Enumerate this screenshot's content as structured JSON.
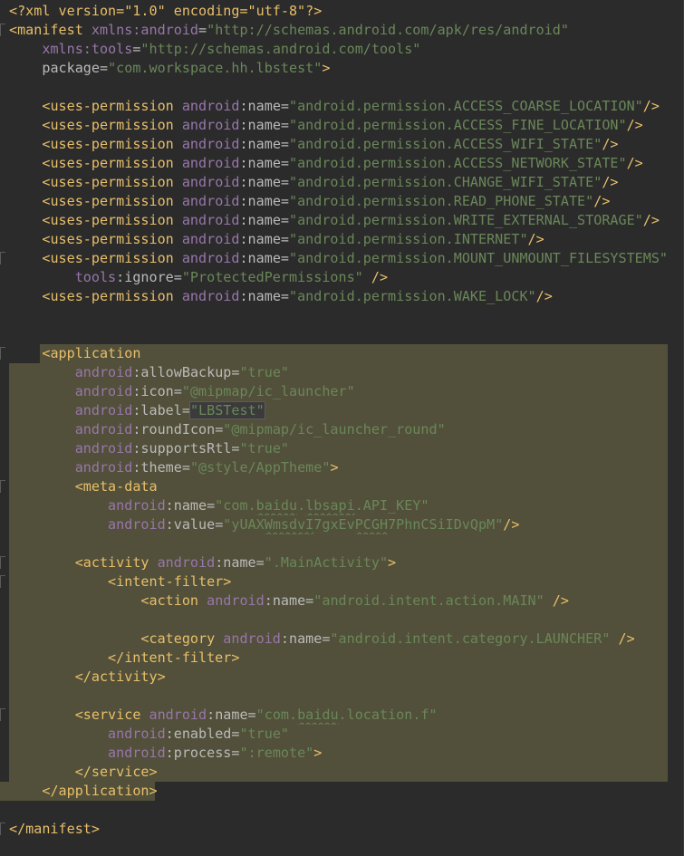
{
  "lines": [
    {
      "t": "decl",
      "text": "<?xml version=\"1.0\" encoding=\"utf-8\"?>"
    },
    {
      "t": "raw",
      "parts": [
        [
          "tag",
          "<manifest "
        ],
        [
          "ns",
          "xmlns:"
        ],
        [
          "attr",
          ""
        ],
        [
          "ns",
          "android"
        ],
        [
          "attr",
          "="
        ],
        [
          "val",
          "\"http://schemas.android.com/apk/res/android\""
        ]
      ]
    },
    {
      "t": "raw",
      "indent": "    ",
      "parts": [
        [
          "ns",
          "xmlns:"
        ],
        [
          "ns",
          "tools"
        ],
        [
          "attr",
          "="
        ],
        [
          "val",
          "\"http://schemas.android.com/tools\""
        ]
      ]
    },
    {
      "t": "raw",
      "indent": "    ",
      "parts": [
        [
          "attr",
          "package"
        ],
        [
          "attr",
          "="
        ],
        [
          "val",
          "\"com.workspace.hh.lbstest\""
        ],
        [
          "tag",
          ">"
        ]
      ]
    },
    {
      "t": "blank"
    },
    {
      "t": "perm",
      "value": "\"android.permission.ACCESS_COARSE_LOCATION\""
    },
    {
      "t": "perm",
      "value": "\"android.permission.ACCESS_FINE_LOCATION\""
    },
    {
      "t": "perm",
      "value": "\"android.permission.ACCESS_WIFI_STATE\""
    },
    {
      "t": "perm",
      "value": "\"android.permission.ACCESS_NETWORK_STATE\""
    },
    {
      "t": "perm",
      "value": "\"android.permission.CHANGE_WIFI_STATE\""
    },
    {
      "t": "perm",
      "value": "\"android.permission.READ_PHONE_STATE\""
    },
    {
      "t": "perm",
      "value": "\"android.permission.WRITE_EXTERNAL_STORAGE\""
    },
    {
      "t": "perm",
      "value": "\"android.permission.INTERNET\""
    },
    {
      "t": "perm_open",
      "value": "\"android.permission.MOUNT_UNMOUNT_FILESYSTEMS\""
    },
    {
      "t": "raw",
      "indent": "        ",
      "parts": [
        [
          "ns",
          "tools"
        ],
        [
          "attr",
          ":ignore="
        ],
        [
          "val",
          "\"ProtectedPermissions\""
        ],
        [
          "tag",
          " />"
        ]
      ]
    },
    {
      "t": "perm",
      "value": "\"android.permission.WAKE_LOCK\""
    },
    {
      "t": "blank"
    },
    {
      "t": "blank"
    },
    {
      "t": "app_open",
      "text": "<application"
    },
    {
      "t": "sel",
      "indent": "        ",
      "parts": [
        [
          "ns",
          "android"
        ],
        [
          "attr",
          ":allowBackup="
        ],
        [
          "val",
          "\"true\""
        ]
      ]
    },
    {
      "t": "sel",
      "indent": "        ",
      "parts": [
        [
          "ns",
          "android"
        ],
        [
          "attr",
          ":icon="
        ],
        [
          "val",
          "\"@mipmap/ic_launcher\""
        ]
      ]
    },
    {
      "t": "sel",
      "indent": "        ",
      "parts": [
        [
          "ns",
          "android"
        ],
        [
          "attr",
          ":label="
        ],
        [
          "valbox",
          "\"LBSTest\""
        ]
      ]
    },
    {
      "t": "sel",
      "indent": "        ",
      "parts": [
        [
          "ns",
          "android"
        ],
        [
          "attr",
          ":roundIcon="
        ],
        [
          "val",
          "\"@mipmap/ic_launcher_round\""
        ]
      ]
    },
    {
      "t": "sel",
      "indent": "        ",
      "parts": [
        [
          "ns",
          "android"
        ],
        [
          "attr",
          ":supportsRtl="
        ],
        [
          "val",
          "\"true\""
        ]
      ]
    },
    {
      "t": "sel",
      "indent": "        ",
      "parts": [
        [
          "ns",
          "android"
        ],
        [
          "attr",
          ":theme="
        ],
        [
          "val",
          "\"@style/AppTheme\""
        ],
        [
          "tag",
          ">"
        ]
      ]
    },
    {
      "t": "sel",
      "indent": "        ",
      "parts": [
        [
          "tag",
          "<meta-data"
        ]
      ]
    },
    {
      "t": "sel",
      "indent": "            ",
      "parts": [
        [
          "ns",
          "android"
        ],
        [
          "attr",
          ":name="
        ],
        [
          "val",
          "\"com."
        ],
        [
          "valsq",
          "baidu"
        ],
        [
          "val",
          "."
        ],
        [
          "valsq",
          "lbsapi"
        ],
        [
          "val",
          ".API_KEY\""
        ]
      ]
    },
    {
      "t": "sel",
      "indent": "            ",
      "parts": [
        [
          "ns",
          "android"
        ],
        [
          "attr",
          ":value="
        ],
        [
          "val",
          "\"yUAX"
        ],
        [
          "valsq",
          "WmsdvI"
        ],
        [
          "val",
          "7gxEv"
        ],
        [
          "valsq",
          "PCGH"
        ],
        [
          "val",
          "7PhnCSiIDvQpM\""
        ],
        [
          "tag",
          "/>"
        ]
      ]
    },
    {
      "t": "sel",
      "parts": []
    },
    {
      "t": "sel",
      "indent": "        ",
      "parts": [
        [
          "tag",
          "<activity "
        ],
        [
          "ns",
          "android"
        ],
        [
          "attr",
          ":name="
        ],
        [
          "val",
          "\".MainActivity\""
        ],
        [
          "tag",
          ">"
        ]
      ]
    },
    {
      "t": "sel",
      "indent": "            ",
      "parts": [
        [
          "tag",
          "<intent-filter>"
        ]
      ]
    },
    {
      "t": "sel",
      "indent": "                ",
      "parts": [
        [
          "tag",
          "<action "
        ],
        [
          "ns",
          "android"
        ],
        [
          "attr",
          ":name="
        ],
        [
          "val",
          "\"android.intent.action.MAIN\""
        ],
        [
          "tag",
          " />"
        ]
      ]
    },
    {
      "t": "sel",
      "parts": []
    },
    {
      "t": "sel",
      "indent": "                ",
      "parts": [
        [
          "tag",
          "<category "
        ],
        [
          "ns",
          "android"
        ],
        [
          "attr",
          ":name="
        ],
        [
          "val",
          "\"android.intent.category.LAUNCHER\""
        ],
        [
          "tag",
          " />"
        ]
      ]
    },
    {
      "t": "sel",
      "indent": "            ",
      "parts": [
        [
          "tag",
          "</intent-filter>"
        ]
      ]
    },
    {
      "t": "sel",
      "indent": "        ",
      "parts": [
        [
          "tag",
          "</activity>"
        ]
      ]
    },
    {
      "t": "sel",
      "parts": []
    },
    {
      "t": "sel",
      "indent": "        ",
      "parts": [
        [
          "tag",
          "<service "
        ],
        [
          "ns",
          "android"
        ],
        [
          "attr",
          ":name="
        ],
        [
          "val",
          "\"com."
        ],
        [
          "valsq",
          "baidu"
        ],
        [
          "val",
          ".location.f\""
        ]
      ]
    },
    {
      "t": "sel",
      "indent": "            ",
      "parts": [
        [
          "ns",
          "android"
        ],
        [
          "attr",
          ":enabled="
        ],
        [
          "val",
          "\"true\""
        ]
      ]
    },
    {
      "t": "sel",
      "indent": "            ",
      "parts": [
        [
          "ns",
          "android"
        ],
        [
          "attr",
          ":process="
        ],
        [
          "val",
          "\":remote\""
        ],
        [
          "tag",
          ">"
        ]
      ]
    },
    {
      "t": "sel",
      "indent": "        ",
      "parts": [
        [
          "tag",
          "</service>"
        ]
      ]
    },
    {
      "t": "app_close",
      "text": "</application>"
    },
    {
      "t": "blank"
    },
    {
      "t": "raw",
      "parts": [
        [
          "tag",
          "</manifest>"
        ]
      ]
    }
  ],
  "perm_tag": "<uses-permission ",
  "perm_ns": "android",
  "perm_attr": ":name=",
  "perm_close": "/>",
  "colors": {
    "background": "#2b2b2b",
    "selection": "#52503a",
    "tag": "#e8bf6a",
    "namespace": "#9876aa",
    "attribute": "#bababa",
    "value": "#6a8759"
  }
}
